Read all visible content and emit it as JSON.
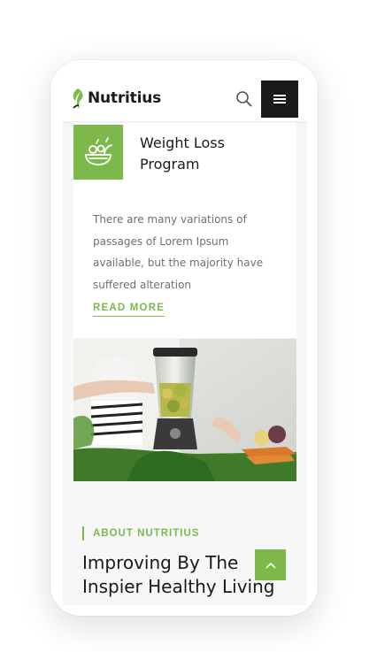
{
  "header": {
    "brand": "Nutritius",
    "icons": {
      "logo": "leaf-logo-icon",
      "search": "search-icon",
      "menu": "hamburger-menu-icon"
    }
  },
  "service_card": {
    "icon": "salad-bowl-icon",
    "title_line1": "Weight Loss",
    "title_line2": "Program",
    "text_lines": [
      "There are many variations of",
      "passages of Lorem Ipsum",
      "available, but the majority have",
      "suffered alteration"
    ],
    "read_more": "READ MORE"
  },
  "about": {
    "label": "ABOUT NUTRITIUS",
    "title_line1": "Improving By The",
    "title_line2": "Inspier Healthy Living"
  },
  "scroll_top_icon": "chevron-up-icon",
  "colors": {
    "accent": "#7cb84a",
    "dark": "#1a1a1a",
    "body_text": "#707070"
  }
}
